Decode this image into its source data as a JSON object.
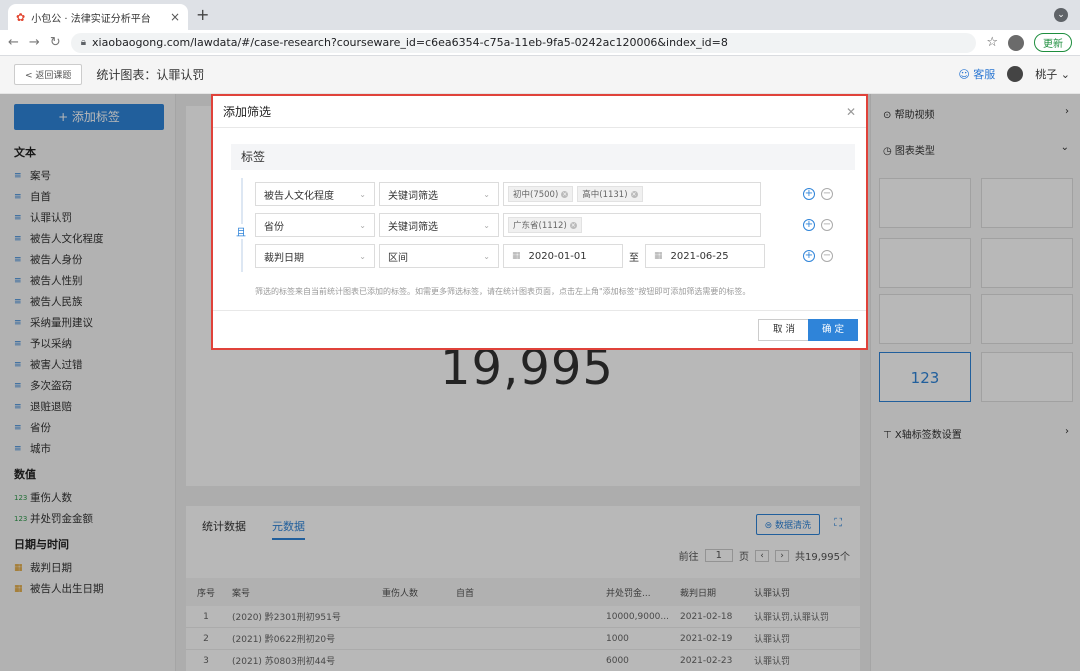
{
  "browser": {
    "tab_title": "小包公 · 法律实证分析平台",
    "url": "xiaobaogong.com/lawdata/#/case-research?courseware_id=c6ea6354-c75a-11eb-9fa5-0242ac120006&index_id=8",
    "update_label": "更新"
  },
  "header": {
    "back_label": "返回课题",
    "page_title": "统计图表：认罪认罚",
    "kefu_label": "客服",
    "username": "桃子"
  },
  "sidebar": {
    "add_tag_label": "+ 添加标签",
    "groups": [
      {
        "title": "文本",
        "items": [
          "案号",
          "自首",
          "认罪认罚",
          "被告人文化程度",
          "被告人身份",
          "被告人性别",
          "被告人民族",
          "采纳量刑建议",
          "予以采纳",
          "被害人过错",
          "多次盗窃",
          "退赃退赔",
          "省份",
          "城市"
        ]
      },
      {
        "title": "数值",
        "items": [
          "重伤人数",
          "并处罚金金额"
        ]
      },
      {
        "title": "日期与时间",
        "items": [
          "裁判日期",
          "被告人出生日期"
        ]
      }
    ]
  },
  "main": {
    "big_number": "19,995",
    "tabs": [
      "统计数据",
      "元数据"
    ],
    "clean_label": "数据清洗",
    "pager": {
      "goto": "前往",
      "page": "1",
      "page_unit": "页",
      "total": "共19,995个"
    },
    "columns": [
      "序号",
      "案号",
      "重伤人数",
      "自首",
      "并处罚金...",
      "裁判日期",
      "认罪认罚"
    ],
    "rows": [
      [
        "1",
        "(2020) 黔2301刑初951号",
        "",
        "",
        "10000,9000...",
        "2021-02-18",
        "认罪认罚,认罪认罚"
      ],
      [
        "2",
        "(2021) 黔0622刑初20号",
        "",
        "",
        "1000",
        "2021-02-19",
        "认罪认罚"
      ],
      [
        "3",
        "(2021) 苏0803刑初44号",
        "",
        "",
        "6000",
        "2021-02-23",
        "认罪认罚"
      ]
    ]
  },
  "right_panel": {
    "help_video": "帮助视频",
    "chart_type": "图表类型",
    "tile_123": "123",
    "xaxis_setting": "X轴标签数设置"
  },
  "modal": {
    "title": "添加筛选",
    "section_title": "标签",
    "conj": "且",
    "rows": [
      {
        "field": "被告人文化程度",
        "mode": "关键词筛选",
        "chips": [
          "初中(7500)",
          "高中(1131)"
        ]
      },
      {
        "field": "省份",
        "mode": "关键词筛选",
        "chips": [
          "广东省(1112)"
        ]
      },
      {
        "field": "裁判日期",
        "mode": "区间",
        "date_from": "2020-01-01",
        "to_label": "至",
        "date_to": "2021-06-25"
      }
    ],
    "note": "筛选的标签来自当前统计图表已添加的标签。如需更多筛选标签，请在统计图表页面，点击左上角\"添加标签\"按钮即可添加筛选需要的标签。",
    "cancel_label": "取 消",
    "ok_label": "确 定"
  },
  "colors": {
    "accent": "#2f84d9",
    "highlight_border": "#e0423a"
  }
}
